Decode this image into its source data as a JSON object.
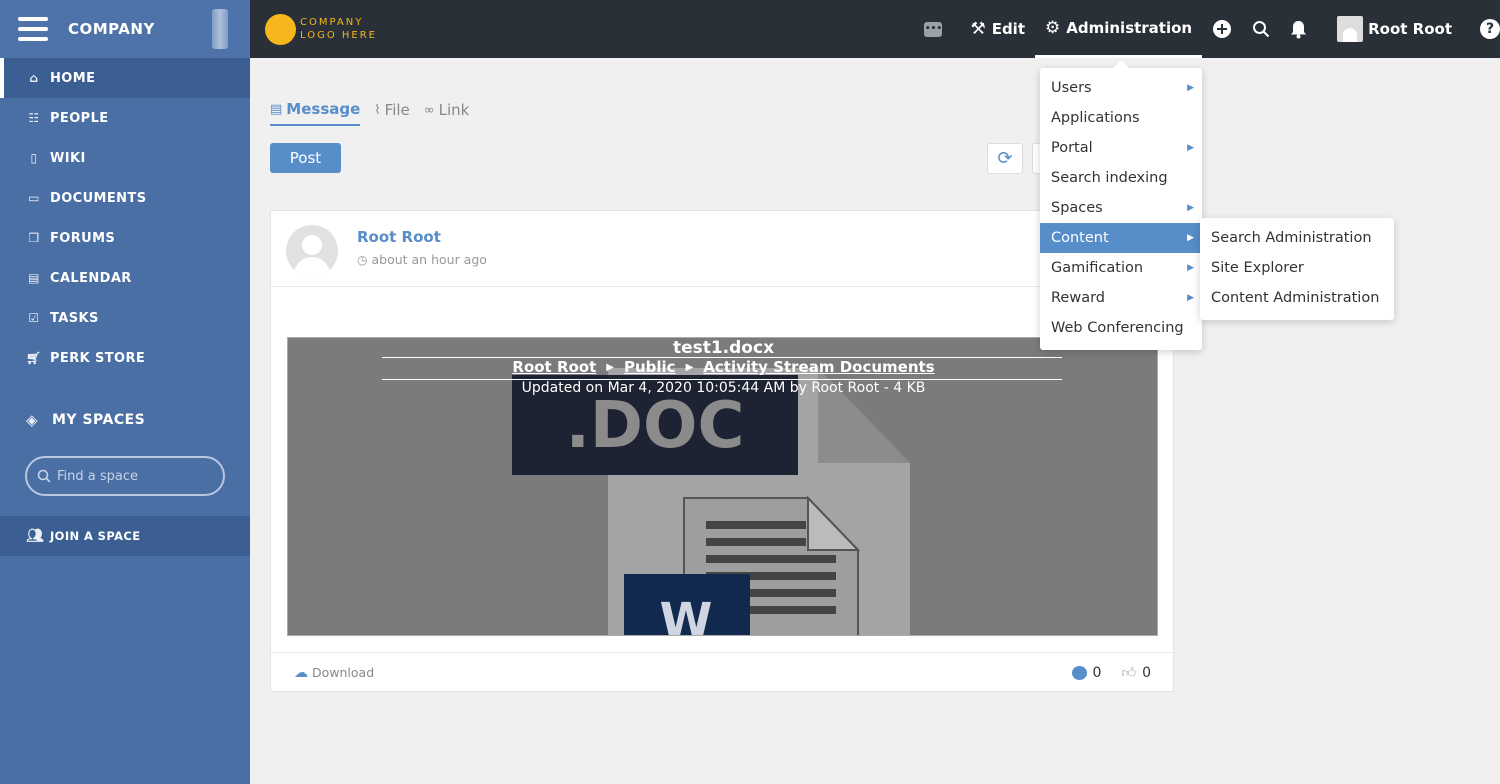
{
  "sidebar": {
    "company": "COMPANY",
    "nav": [
      {
        "label": "HOME",
        "icon": "home-icon"
      },
      {
        "label": "PEOPLE",
        "icon": "people-icon"
      },
      {
        "label": "WIKI",
        "icon": "book-icon"
      },
      {
        "label": "DOCUMENTS",
        "icon": "folder-icon"
      },
      {
        "label": "FORUMS",
        "icon": "forum-icon"
      },
      {
        "label": "CALENDAR",
        "icon": "calendar-icon"
      },
      {
        "label": "TASKS",
        "icon": "check-square-icon"
      },
      {
        "label": "PERK STORE",
        "icon": "cart-icon"
      }
    ],
    "my_spaces": "MY SPACES",
    "find_space_placeholder": "Find a space",
    "join_space": "JOIN A SPACE"
  },
  "topbar": {
    "logo_line1": "COMPANY",
    "logo_line2": "LOGO HERE",
    "edit": "Edit",
    "administration": "Administration",
    "user": "Root Root",
    "help": "?"
  },
  "composer": {
    "tabs": [
      "Message",
      "File",
      "Link"
    ],
    "post": "Post"
  },
  "activity": {
    "author": "Root Root",
    "time": "about an hour ago",
    "file_title": "test1.docx",
    "breadcrumb": [
      "Root Root",
      "Public",
      "Activity Stream Documents"
    ],
    "meta": "Updated on Mar 4, 2020 10:05:44 AM by Root Root - 4 KB",
    "doc_label": ".DOC",
    "download": "Download",
    "comments": "0",
    "likes": "0"
  },
  "admin_menu": {
    "items": [
      {
        "label": "Users",
        "submenu": true
      },
      {
        "label": "Applications",
        "submenu": false
      },
      {
        "label": "Portal",
        "submenu": true
      },
      {
        "label": "Search indexing",
        "submenu": false
      },
      {
        "label": "Spaces",
        "submenu": true
      },
      {
        "label": "Content",
        "submenu": true
      },
      {
        "label": "Gamification",
        "submenu": true
      },
      {
        "label": "Reward",
        "submenu": true
      },
      {
        "label": "Web Conferencing",
        "submenu": false
      }
    ],
    "content_submenu": [
      "Search Administration",
      "Site Explorer",
      "Content Administration"
    ]
  },
  "colors": {
    "sidebar": "#4a6fa5",
    "topbar": "#293038",
    "accent": "#578dc9",
    "logo": "#f6b71d"
  }
}
